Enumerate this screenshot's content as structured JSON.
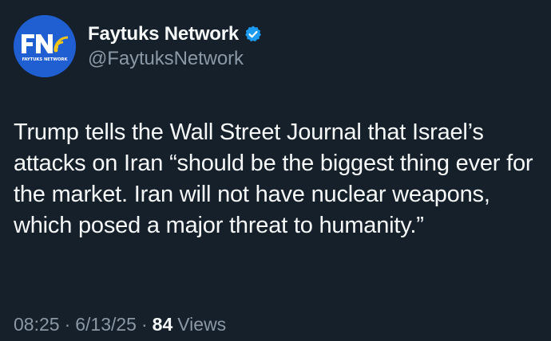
{
  "author": {
    "display_name": "Faytuks Network",
    "handle": "@FaytuksNetwork",
    "verified": true,
    "avatar": {
      "logo_text": "FN",
      "logo_subtext": "FAYTUKS NETWORK",
      "background_color": "#1f5fd1",
      "accent_color": "#f5c518"
    }
  },
  "tweet": {
    "text": "Trump tells the Wall Street Journal that Israel’s attacks on Iran “should be the biggest thing ever for the market. Iran will not have nuclear weapons, which posed a major threat to humanity.”"
  },
  "meta": {
    "time": "08:25",
    "separator": "·",
    "date": "6/13/25",
    "views_count": "84",
    "views_label": "Views"
  },
  "colors": {
    "background": "#15202b",
    "primary_text": "#f7f9f9",
    "secondary_text": "#8b98a5",
    "verified_badge": "#1d9bf0"
  },
  "icons": {
    "verified": "verified-badge-icon"
  }
}
